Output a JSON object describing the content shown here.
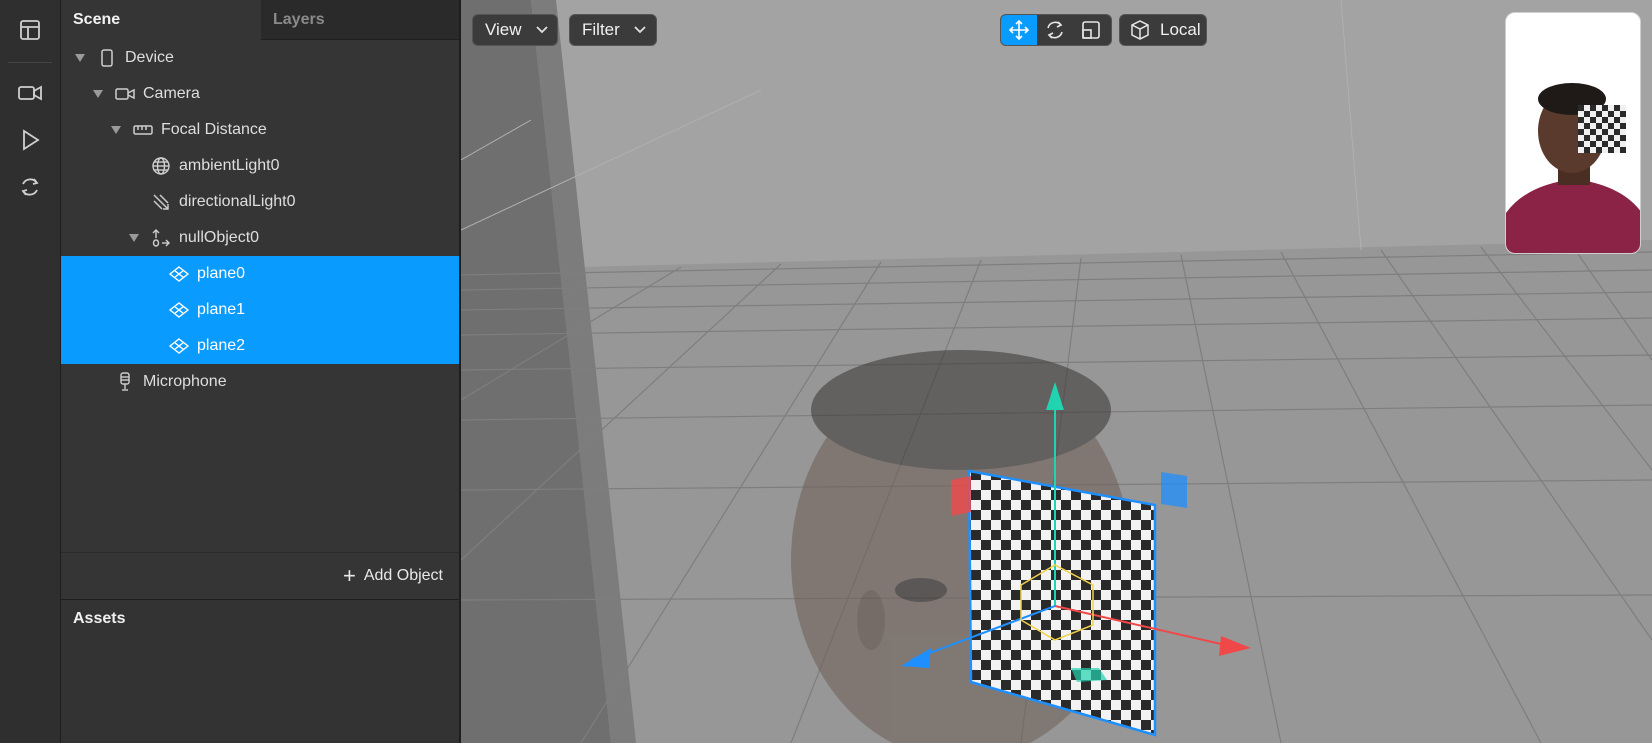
{
  "rail": {
    "icons": [
      "layout-icon",
      "video-camera-icon",
      "play-icon",
      "refresh-icon"
    ]
  },
  "scene_panel": {
    "tabs": [
      {
        "label": "Scene",
        "active": true
      },
      {
        "label": "Layers",
        "active": false
      }
    ],
    "tree": [
      {
        "label": "Device",
        "icon": "phone-icon",
        "expanded": true,
        "selected": false
      },
      {
        "label": "Camera",
        "icon": "camera-icon",
        "expanded": true,
        "selected": false
      },
      {
        "label": "Focal Distance",
        "icon": "ruler-icon",
        "expanded": true,
        "selected": false
      },
      {
        "label": "ambientLight0",
        "icon": "globe-icon",
        "selected": false
      },
      {
        "label": "directionalLight0",
        "icon": "directional-light-icon",
        "selected": false
      },
      {
        "label": "nullObject0",
        "icon": "null-object-icon",
        "expanded": true,
        "selected": false
      },
      {
        "label": "plane0",
        "icon": "plane-icon",
        "selected": true
      },
      {
        "label": "plane1",
        "icon": "plane-icon",
        "selected": true
      },
      {
        "label": "plane2",
        "icon": "plane-icon",
        "selected": true
      },
      {
        "label": "Microphone",
        "icon": "microphone-icon",
        "selected": false
      }
    ],
    "add_object_label": "Add Object",
    "assets_title": "Assets"
  },
  "viewport": {
    "view_label": "View",
    "filter_label": "Filter",
    "transform_tools": [
      "move-icon",
      "rotate-icon",
      "scale-icon"
    ],
    "active_tool": "move-icon",
    "space_label": "Local"
  },
  "colors": {
    "selection": "#0a9bff",
    "panel": "#353535",
    "viewport_bg": "#9a9a9a",
    "axis_x": "#f04848",
    "axis_y": "#22d3b0",
    "axis_z": "#1e8fff"
  }
}
